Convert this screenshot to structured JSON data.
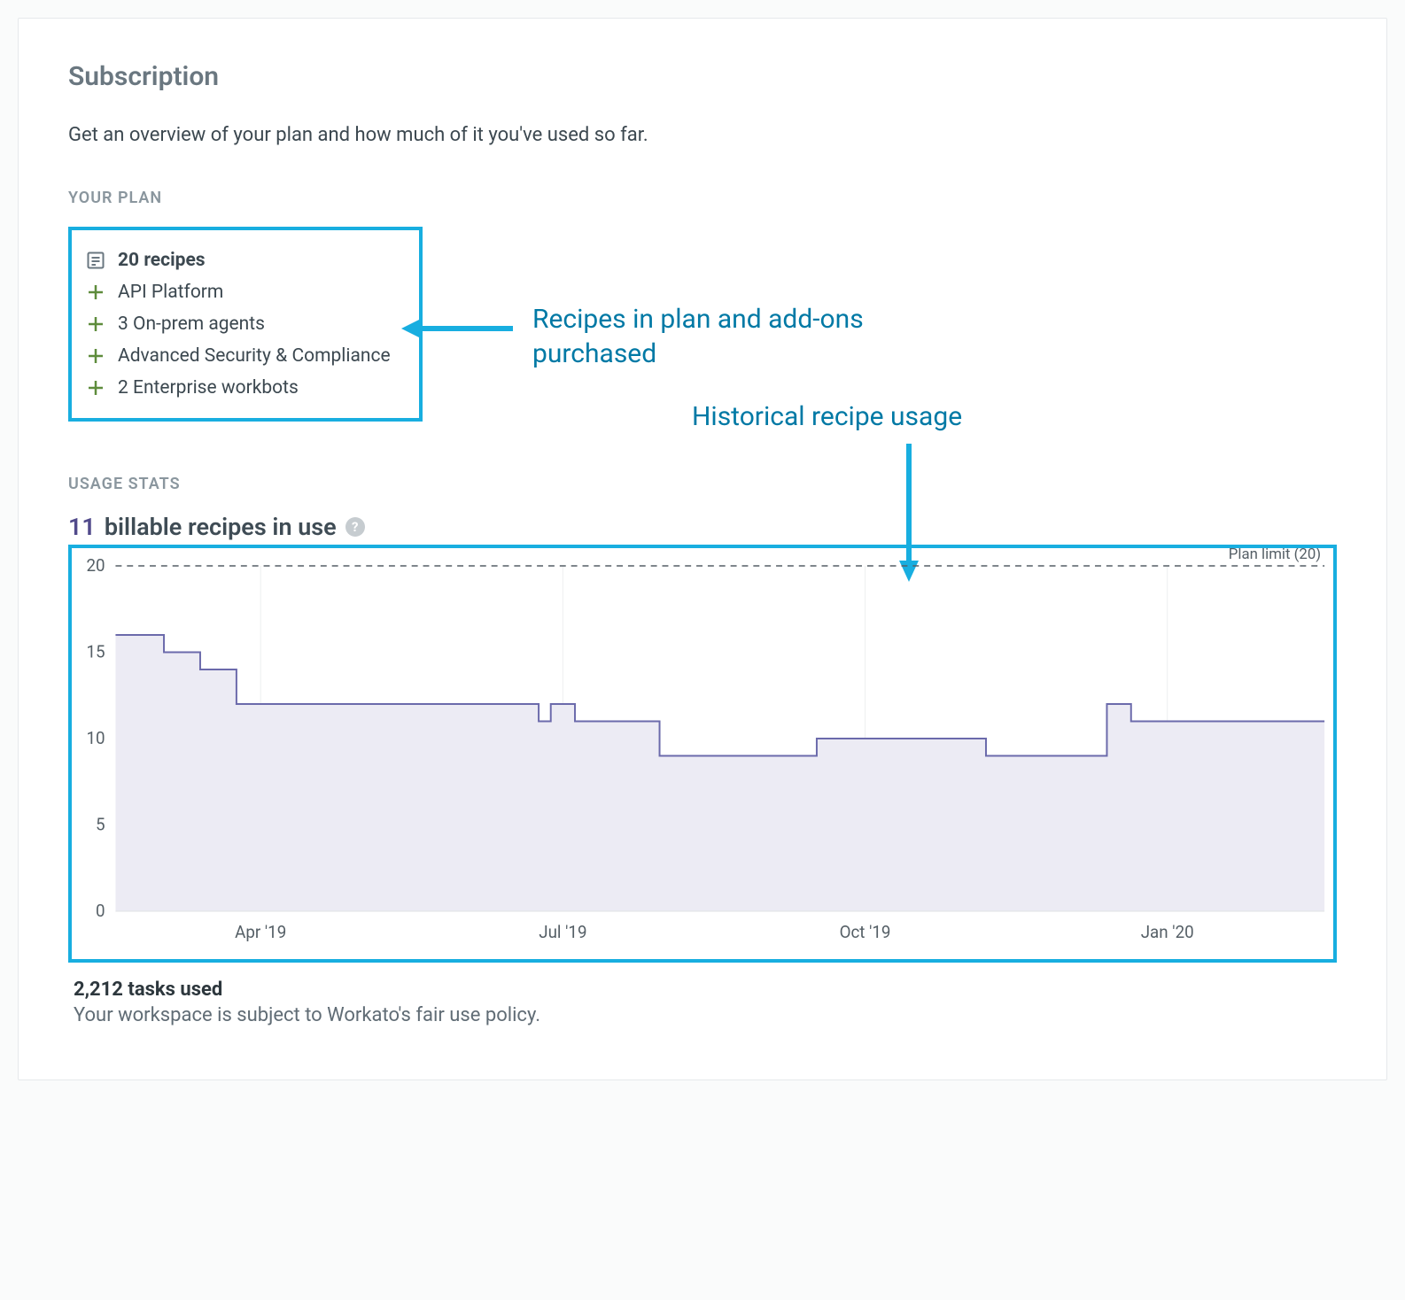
{
  "header": {
    "title": "Subscription",
    "subtitle": "Get an overview of your plan and how much of it you've used so far."
  },
  "plan": {
    "section_label": "YOUR PLAN",
    "headline": "20 recipes",
    "items": [
      "API Platform",
      "3 On-prem agents",
      "Advanced Security & Compliance",
      "2 Enterprise workbots"
    ]
  },
  "usage": {
    "section_label": "USAGE STATS",
    "count": "11",
    "count_label": "billable recipes in use",
    "plan_limit_label": "Plan limit (20)",
    "help_tooltip": "?"
  },
  "annotations": {
    "plan_callout": "Recipes in plan and add-ons purchased",
    "chart_callout": "Historical recipe usage"
  },
  "footer": {
    "tasks_used": "2,212 tasks used",
    "fair_use": "Your workspace is subject to Workato's fair use policy."
  },
  "chart_data": {
    "type": "area",
    "title": "",
    "xlabel": "",
    "ylabel": "",
    "ylim": [
      0,
      20
    ],
    "y_ticks": [
      0,
      5,
      10,
      15,
      20
    ],
    "x_ticks": [
      "Apr '19",
      "Jul '19",
      "Oct '19",
      "Jan '20"
    ],
    "plan_limit": 20,
    "series": [
      {
        "name": "billable recipes",
        "color": "#6b6aab",
        "fill": "#ecebf4",
        "points": [
          {
            "x": 0.0,
            "y": 16
          },
          {
            "x": 0.04,
            "y": 16
          },
          {
            "x": 0.04,
            "y": 15
          },
          {
            "x": 0.07,
            "y": 15
          },
          {
            "x": 0.07,
            "y": 14
          },
          {
            "x": 0.1,
            "y": 14
          },
          {
            "x": 0.1,
            "y": 12
          },
          {
            "x": 0.35,
            "y": 12
          },
          {
            "x": 0.35,
            "y": 11
          },
          {
            "x": 0.36,
            "y": 11
          },
          {
            "x": 0.36,
            "y": 12
          },
          {
            "x": 0.38,
            "y": 12
          },
          {
            "x": 0.38,
            "y": 11
          },
          {
            "x": 0.45,
            "y": 11
          },
          {
            "x": 0.45,
            "y": 9
          },
          {
            "x": 0.58,
            "y": 9
          },
          {
            "x": 0.58,
            "y": 10
          },
          {
            "x": 0.72,
            "y": 10
          },
          {
            "x": 0.72,
            "y": 9
          },
          {
            "x": 0.82,
            "y": 9
          },
          {
            "x": 0.82,
            "y": 12
          },
          {
            "x": 0.84,
            "y": 12
          },
          {
            "x": 0.84,
            "y": 11
          },
          {
            "x": 1.0,
            "y": 11
          }
        ]
      }
    ]
  }
}
